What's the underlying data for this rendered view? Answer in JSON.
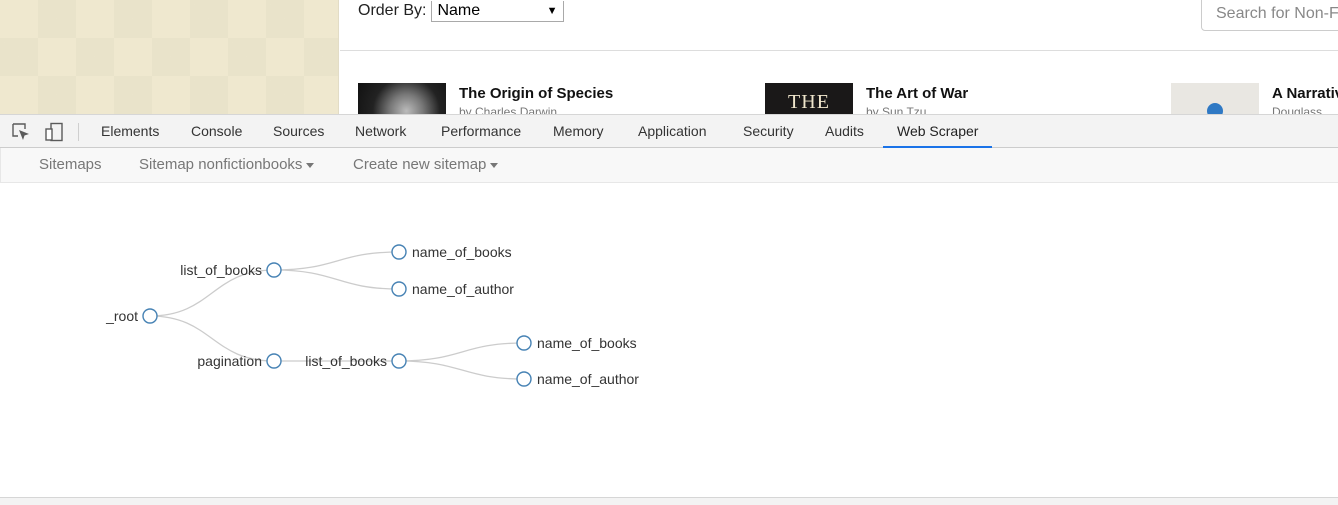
{
  "site": {
    "order_label": "Order By:",
    "order_value": "Name",
    "search_placeholder": "Search for Non-F",
    "books": [
      {
        "title": "The Origin of Species",
        "author": "by Charles Darwin"
      },
      {
        "title": "The Art of War",
        "author": "by Sun Tzu",
        "cover_text": "THE"
      },
      {
        "title": "A Narrativ",
        "author": "Douglass"
      }
    ]
  },
  "devtools": {
    "tabs": [
      "Elements",
      "Console",
      "Sources",
      "Network",
      "Performance",
      "Memory",
      "Application",
      "Security",
      "Audits",
      "Web Scraper"
    ],
    "active_tab": "Web Scraper",
    "icons": [
      "inspect-element-icon",
      "device-toolbar-icon"
    ]
  },
  "webscraper": {
    "nav": {
      "sitemaps": "Sitemaps",
      "sitemap_menu": "Sitemap nonfictionbooks",
      "create_menu": "Create new sitemap"
    },
    "tree": {
      "root": "_root",
      "a": "list_of_books",
      "a1": "name_of_books",
      "a2": "name_of_author",
      "b": "pagination",
      "b1": "list_of_books",
      "b1a": "name_of_books",
      "b1b": "name_of_author"
    }
  },
  "colors": {
    "accent": "#1a73e8",
    "node_stroke": "#4682b4",
    "link": "#cccccc"
  }
}
